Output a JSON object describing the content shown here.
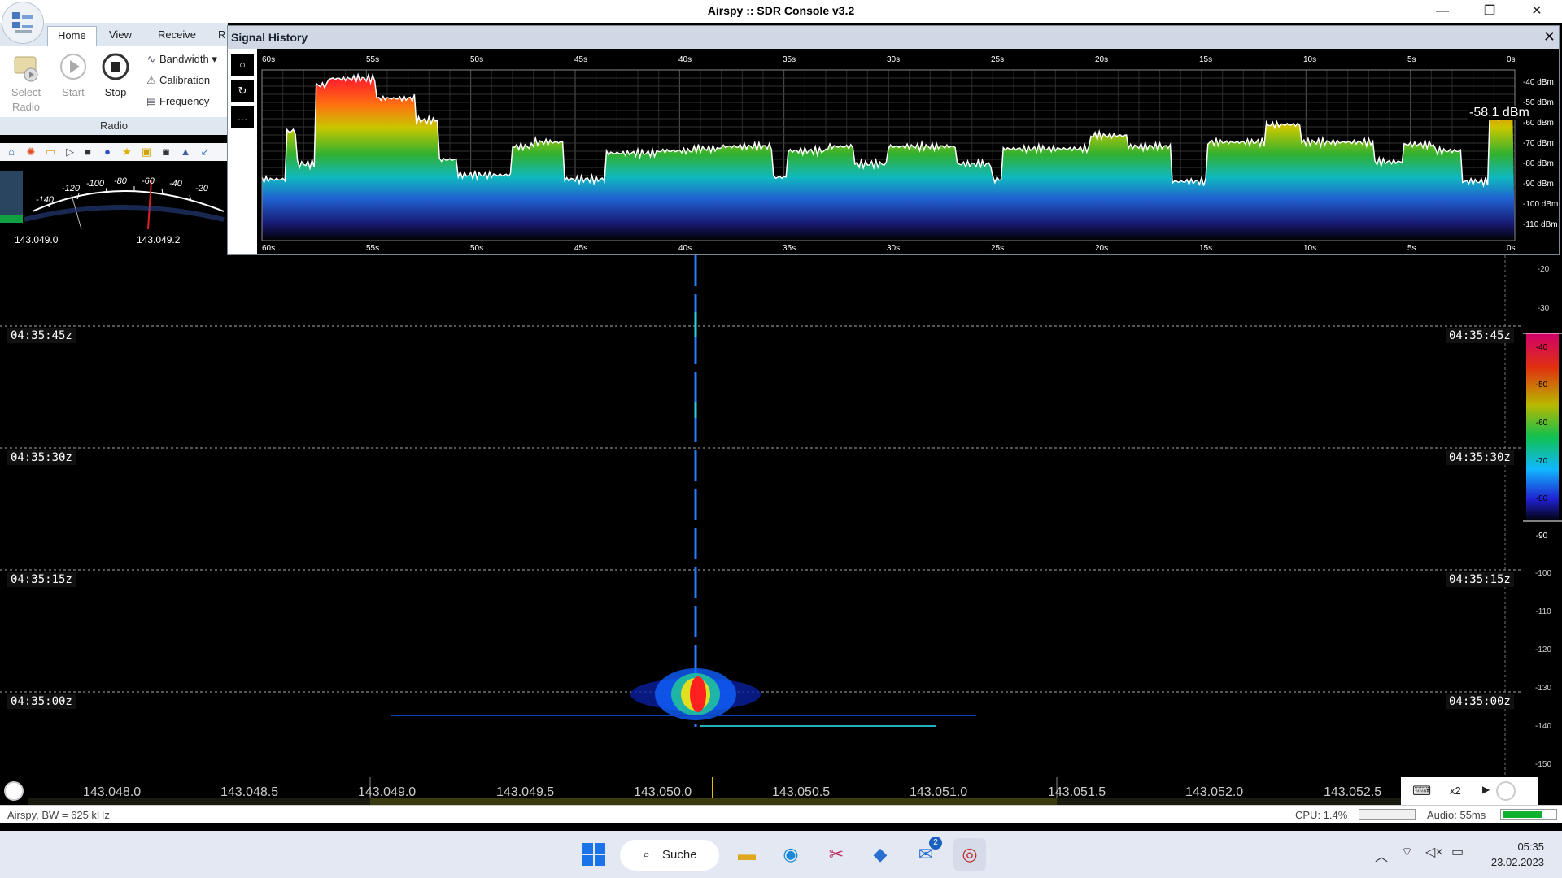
{
  "window": {
    "title": "Airspy :: SDR Console v3.2",
    "controls": [
      "—",
      "❐",
      "✕"
    ]
  },
  "ribbon": {
    "tabs": [
      "Home",
      "View",
      "Receive",
      "R"
    ],
    "select_radio": "Select Radio",
    "start": "Start",
    "stop": "Stop",
    "bandwidth": "Bandwidth",
    "calibration": "Calibration",
    "frequency": "Frequency",
    "group": "Radio"
  },
  "smeter": {
    "scale": [
      "-140",
      "-120",
      "-100",
      "-80",
      "-60",
      "-40",
      "-20"
    ],
    "freq_left": "143.049.0",
    "freq_right": "143.049.2"
  },
  "signal_history": {
    "title": "Signal History",
    "time_labels": [
      "60s",
      "55s",
      "50s",
      "45s",
      "40s",
      "35s",
      "30s",
      "25s",
      "20s",
      "15s",
      "10s",
      "5s",
      "0s"
    ],
    "dbm_labels": [
      "-40 dBm",
      "-50 dBm",
      "-60 dBm",
      "-70 dBm",
      "-80 dBm",
      "-90 dBm",
      "-100 dBm",
      "-110 dBm"
    ],
    "current": "-58.1 dBm",
    "side_buttons": [
      "○",
      "↻",
      "…"
    ]
  },
  "waterfall": {
    "times": [
      "04:35:45z",
      "04:35:30z",
      "04:35:15z",
      "04:35:00z"
    ],
    "scale": [
      "-20",
      "-30",
      "-40",
      "-50",
      "-60",
      "-70",
      "-80",
      "-90",
      "-100",
      "-110",
      "-120",
      "-130",
      "-140",
      "-150"
    ],
    "colors": [
      "#d0006a",
      "#e03010",
      "#b8b800",
      "#10b040",
      "#1060ff",
      "#2020b0"
    ]
  },
  "freqbar": {
    "labels": [
      "143.048.0",
      "143.048.5",
      "143.049.0",
      "143.049.5",
      "143.050.0",
      "143.050.5",
      "143.051.0",
      "143.051.5",
      "143.052.0",
      "143.052.5"
    ],
    "zoom": "x2"
  },
  "status": {
    "left": "Airspy, BW = 625 kHz",
    "cpu": "CPU: 1.4%",
    "audio": "Audio: 55ms"
  },
  "taskbar": {
    "search": "Suche",
    "mail_badge": "2",
    "time": "05:35",
    "date": "23.02.2023"
  }
}
